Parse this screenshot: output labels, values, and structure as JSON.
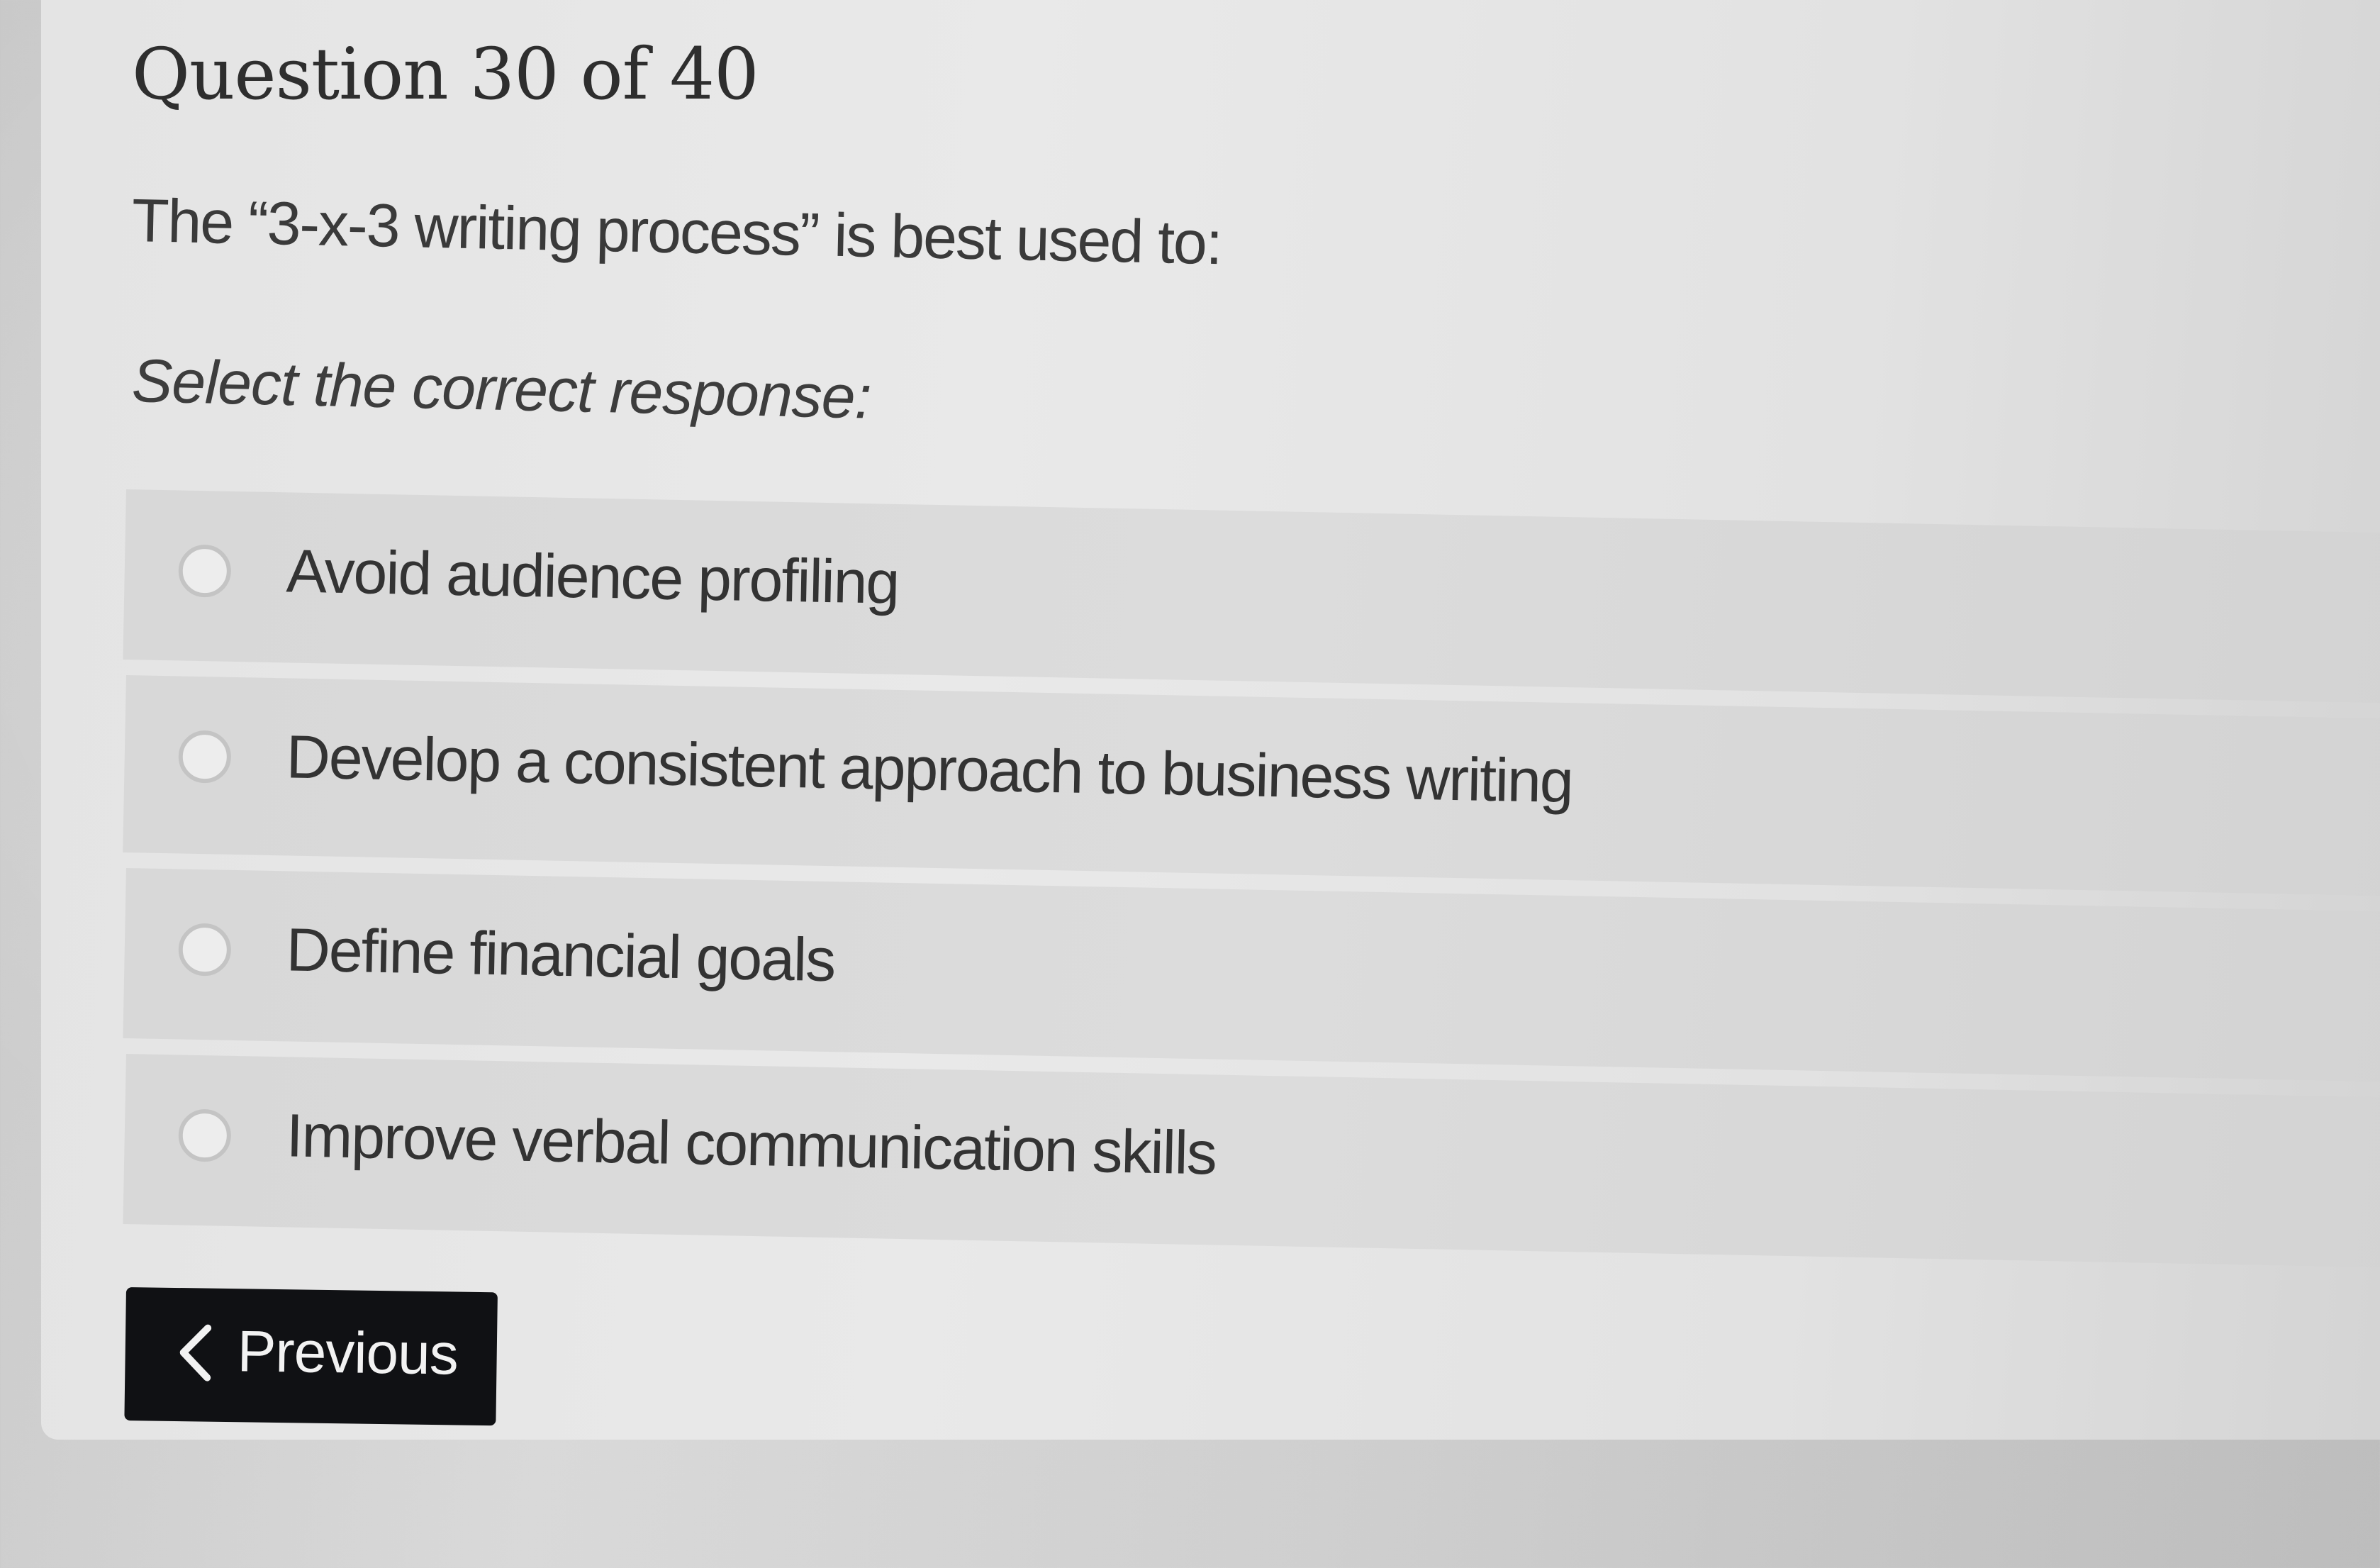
{
  "question": {
    "title": "Question 30 of 40",
    "text": "The “3-x-3 writing process” is best used to:",
    "instruction": "Select the correct response:"
  },
  "options": [
    {
      "label": "Avoid audience profiling",
      "selected": false
    },
    {
      "label": "Develop a consistent approach to business writing",
      "selected": false
    },
    {
      "label": "Define financial goals",
      "selected": false
    },
    {
      "label": "Improve verbal communication skills",
      "selected": false
    }
  ],
  "navigation": {
    "previous_label": "Previous",
    "previous_icon": "chevron-left-icon"
  },
  "colors": {
    "button_bg": "#101114",
    "button_text": "#f2f2f2"
  }
}
